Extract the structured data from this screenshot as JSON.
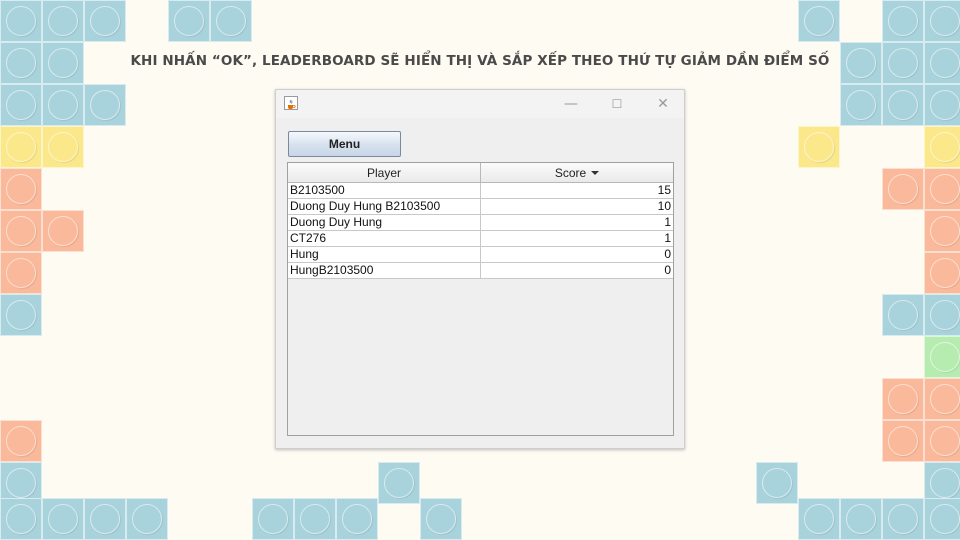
{
  "slide": {
    "caption": "KHI NHẤN “OK”, LEADERBOARD SẼ HIỂN THỊ VÀ SẮP XẾP THEO THỨ TỰ GIẢM DẦN ĐIỂM SỐ"
  },
  "window": {
    "title": "",
    "controls": {
      "minimize": "—",
      "maximize": "☐",
      "close": "✕"
    }
  },
  "toolbar": {
    "menu_label": "Menu"
  },
  "leaderboard": {
    "columns": [
      "Player",
      "Score"
    ],
    "sort": {
      "column": "Score",
      "direction": "descending"
    },
    "rows": [
      {
        "player": "B2103500",
        "score": "15"
      },
      {
        "player": "Duong Duy Hung B2103500",
        "score": "10"
      },
      {
        "player": "Duong Duy Hung",
        "score": "1"
      },
      {
        "player": "CT276",
        "score": "1"
      },
      {
        "player": "Hung",
        "score": "0"
      },
      {
        "player": "HungB2103500",
        "score": "0"
      }
    ]
  },
  "colors": {
    "blue": "#a9d3dc",
    "yellow": "#fbe88a",
    "orange": "#f9b99a",
    "green": "#b7ecb1",
    "background": "#fdfbf2"
  }
}
